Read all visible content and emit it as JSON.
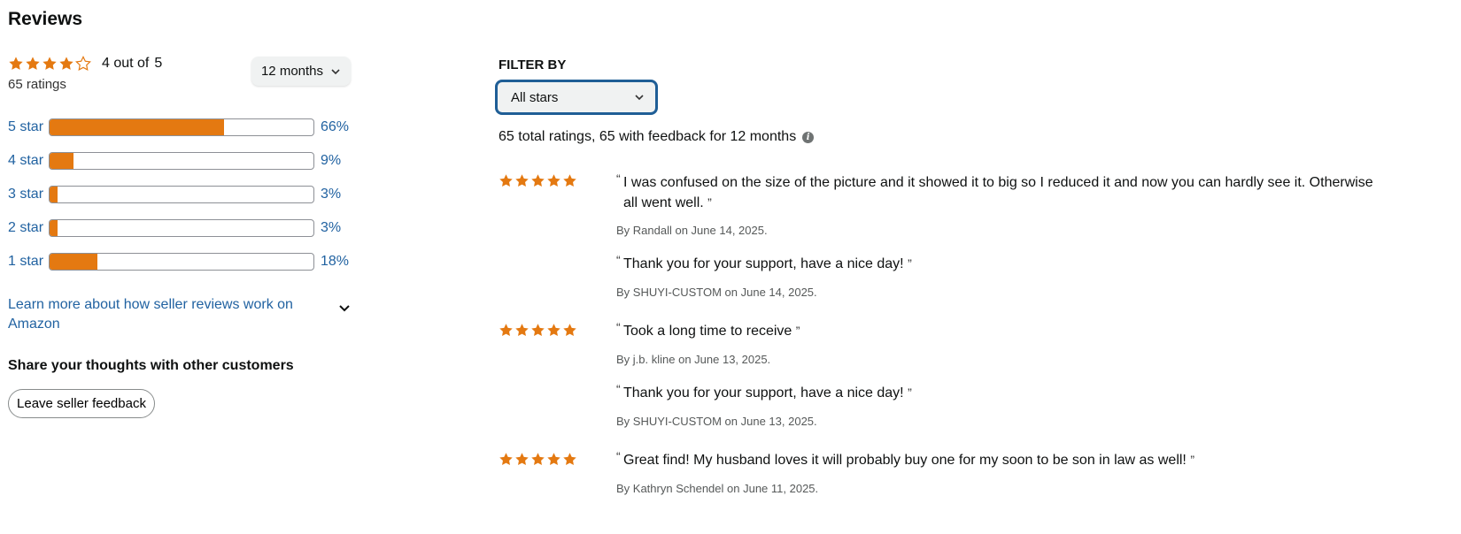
{
  "page": {
    "title": "Reviews"
  },
  "summary": {
    "rating": 4,
    "max": 5,
    "rating_prefix": "4 out of",
    "rating_max": "5",
    "ratings_count": "65 ratings"
  },
  "period_dropdown": {
    "label": "12 months"
  },
  "histogram": [
    {
      "label": "5 star",
      "percent": 66,
      "percent_text": "66%"
    },
    {
      "label": "4 star",
      "percent": 9,
      "percent_text": "9%"
    },
    {
      "label": "3 star",
      "percent": 3,
      "percent_text": "3%"
    },
    {
      "label": "2 star",
      "percent": 3,
      "percent_text": "3%"
    },
    {
      "label": "1 star",
      "percent": 18,
      "percent_text": "18%"
    }
  ],
  "learn_more": {
    "text": "Learn more about how seller reviews work on Amazon"
  },
  "share": {
    "heading": "Share your thoughts with other customers",
    "button": "Leave seller feedback"
  },
  "filter": {
    "label": "FILTER BY",
    "selected": "All stars"
  },
  "total_text": "65 total ratings, 65 with feedback for 12 months",
  "colors": {
    "star": "#e47911",
    "link": "#2162a1",
    "focus_border": "#1f5e96"
  },
  "feedback": [
    {
      "stars": 5,
      "quote": "I was confused on the size of the picture and it showed it to big so I reduced it and now you can hardly see it. Otherwise all went well.",
      "by": "By Randall on June 14, 2025."
    },
    {
      "stars": 0,
      "quote": "Thank you for your support, have a nice day!",
      "by": "By SHUYI-CUSTOM on June 14, 2025."
    },
    {
      "stars": 5,
      "quote": "Took a long time to receive",
      "by": "By j.b. kline on June 13, 2025."
    },
    {
      "stars": 0,
      "quote": "Thank you for your support, have a nice day!",
      "by": "By SHUYI-CUSTOM on June 13, 2025."
    },
    {
      "stars": 5,
      "quote": "Great find! My husband loves it will probably buy one for my soon to be son in law as well!",
      "by": "By Kathryn Schendel on June 11, 2025."
    }
  ]
}
